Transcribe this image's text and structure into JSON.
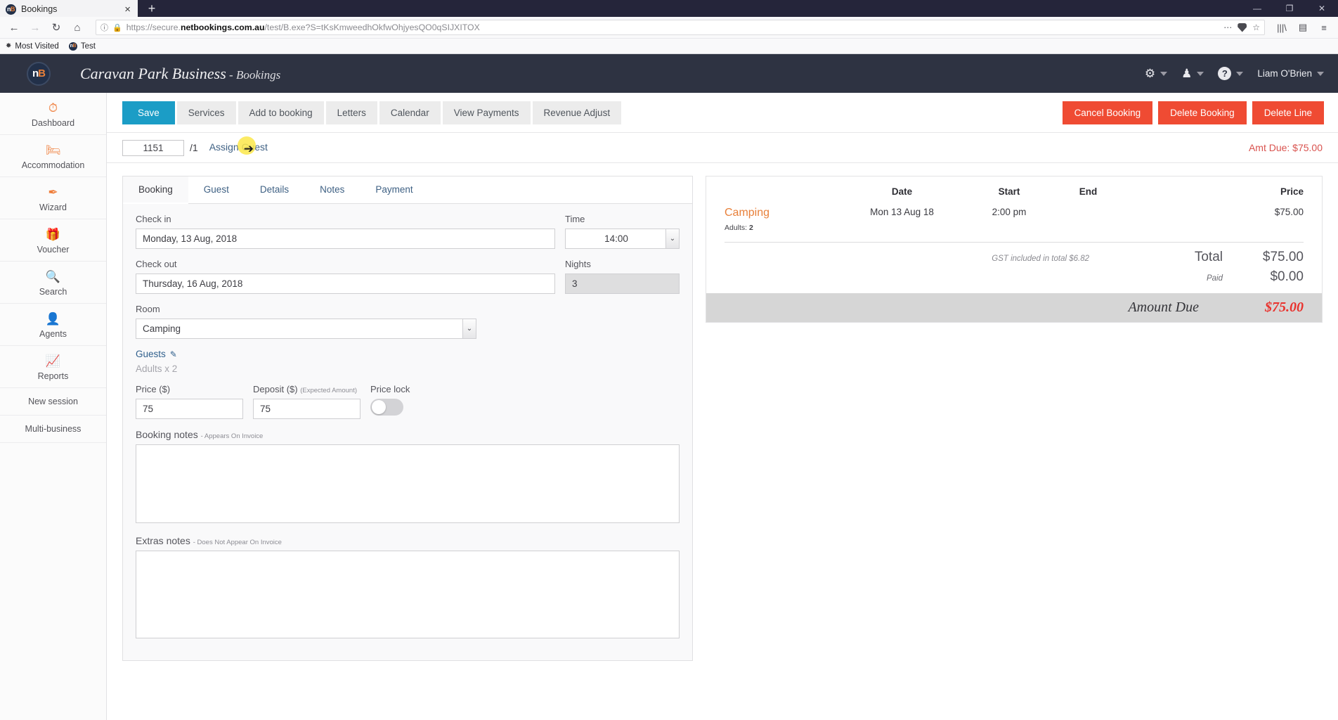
{
  "browser": {
    "tab": {
      "title": "Bookings",
      "favicon_text": "nB",
      "close_icon": "×"
    },
    "new_tab_icon": "+",
    "window_controls": {
      "minimize": "—",
      "maximize": "❐",
      "close": "✕"
    },
    "nav": {
      "back": "←",
      "forward": "→",
      "reload": "↻",
      "home": "⌂"
    },
    "url": {
      "info_icon": "ⓘ",
      "lock_icon": "🔒",
      "prefix": "https://secure.",
      "domain": "netbookings.com.au",
      "path": "/test/B.exe?S=tKsKmweedhOkfwOhjyesQO0qSIJXITOX",
      "menu_icon": "⋯",
      "star_icon": "☆"
    },
    "toolbar_right": {
      "library_icon": "|||\\",
      "sidebar_icon": "▤",
      "menu_icon": "≡"
    },
    "bookmarks": [
      {
        "label": "Most Visited",
        "icon": "✸"
      },
      {
        "label": "Test",
        "icon": "nB"
      }
    ]
  },
  "header": {
    "logo_text": "nB",
    "title_main": "Caravan Park Business",
    "title_separator": " - ",
    "title_sub": "Bookings",
    "gear_icon": "⚙",
    "agent_icon": "♟",
    "help_icon": "?",
    "username": "Liam O'Brien"
  },
  "sidebar": {
    "items": [
      {
        "label": "Dashboard",
        "icon": "⏱"
      },
      {
        "label": "Accommodation",
        "icon": "🛏"
      },
      {
        "label": "Wizard",
        "icon": "✒"
      },
      {
        "label": "Voucher",
        "icon": "🎁"
      },
      {
        "label": "Search",
        "icon": "🔍"
      },
      {
        "label": "Agents",
        "icon": "👤"
      },
      {
        "label": "Reports",
        "icon": "📈"
      }
    ],
    "plain_items": [
      {
        "label": "New session"
      },
      {
        "label": "Multi-business"
      }
    ]
  },
  "toolbar": {
    "buttons": [
      {
        "label": "Save",
        "style": "primary"
      },
      {
        "label": "Services",
        "style": "default"
      },
      {
        "label": "Add to booking",
        "style": "default"
      },
      {
        "label": "Letters",
        "style": "default"
      },
      {
        "label": "Calendar",
        "style": "default"
      },
      {
        "label": "View Payments",
        "style": "default"
      },
      {
        "label": "Revenue Adjust",
        "style": "default"
      }
    ],
    "danger_buttons": [
      {
        "label": "Cancel Booking"
      },
      {
        "label": "Delete Booking"
      },
      {
        "label": "Delete Line"
      }
    ]
  },
  "idbar": {
    "booking_id": "1151",
    "line_of": "/1",
    "assign_guest": "Assign Guest",
    "amount_due_label": "Amt Due: $75.00"
  },
  "tabs": [
    {
      "label": "Booking",
      "active": true
    },
    {
      "label": "Guest",
      "active": false
    },
    {
      "label": "Details",
      "active": false
    },
    {
      "label": "Notes",
      "active": false
    },
    {
      "label": "Payment",
      "active": false
    }
  ],
  "form": {
    "checkin_label": "Check in",
    "checkin_value": "Monday, 13 Aug, 2018",
    "time_label": "Time",
    "time_value": "14:00",
    "checkout_label": "Check out",
    "checkout_value": "Thursday, 16 Aug, 2018",
    "nights_label": "Nights",
    "nights_value": "3",
    "room_label": "Room",
    "room_value": "Camping",
    "guests_label": "Guests",
    "guests_edit_icon": "✎",
    "guests_summary": "Adults x 2",
    "price_label": "Price ($)",
    "price_value": "75",
    "deposit_label": "Deposit ($)",
    "deposit_sublabel": "(Expected Amount)",
    "deposit_value": "75",
    "price_lock_label": "Price lock",
    "price_lock_on": false,
    "booking_notes_label": "Booking notes",
    "booking_notes_sublabel": "- Appears On Invoice",
    "booking_notes_value": "",
    "extras_notes_label": "Extras notes",
    "extras_notes_sublabel": "- Does Not Appear On Invoice",
    "extras_notes_value": "",
    "dropdown_caret": "⌄"
  },
  "summary": {
    "columns": {
      "service": "",
      "date": "Date",
      "start": "Start",
      "end": "End",
      "price": "Price"
    },
    "rows": [
      {
        "service": "Camping",
        "date": "Mon 13 Aug 18",
        "start": "2:00 pm",
        "end": "",
        "price": "$75.00",
        "detail_label": "Adults:",
        "detail_value": "2"
      }
    ],
    "gst_note": "GST included in total $6.82",
    "total_label": "Total",
    "total_value": "$75.00",
    "paid_label": "Paid",
    "paid_value": "$0.00",
    "due_label": "Amount Due",
    "due_value": "$75.00"
  }
}
